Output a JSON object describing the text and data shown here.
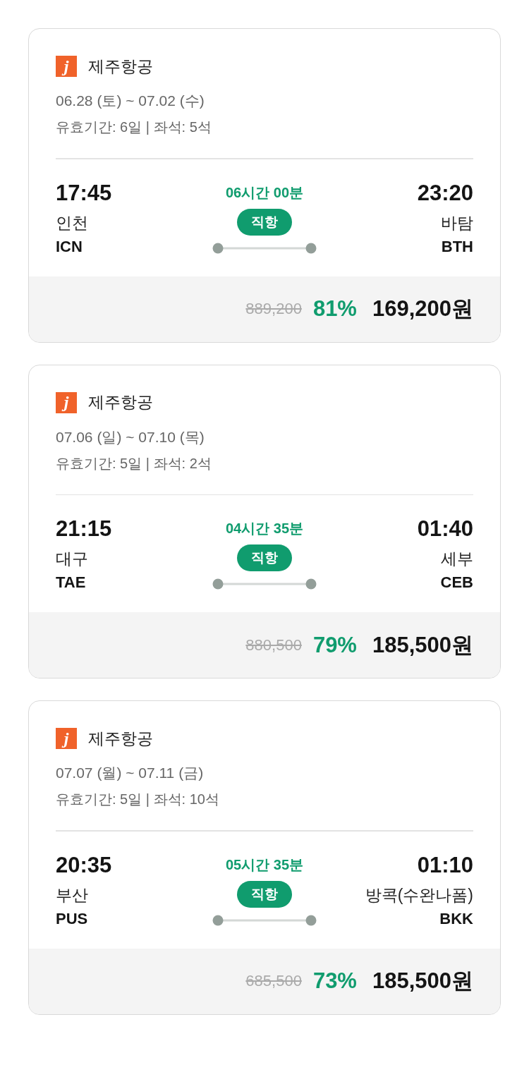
{
  "flights": [
    {
      "airline": "제주항공",
      "logo": "j",
      "dates": "06.28 (토) ~ 07.02 (수)",
      "info": "유효기간: 6일 | 좌석: 5석",
      "depart_time": "17:45",
      "depart_city": "인천",
      "depart_code": "ICN",
      "duration": "06시간 00분",
      "route_type": "직항",
      "arrive_time": "23:20",
      "arrive_city": "바탐",
      "arrive_code": "BTH",
      "original_price": "889,200",
      "discount": "81%",
      "price": "169,200원"
    },
    {
      "airline": "제주항공",
      "logo": "j",
      "dates": "07.06 (일) ~ 07.10 (목)",
      "info": "유효기간: 5일 | 좌석: 2석",
      "depart_time": "21:15",
      "depart_city": "대구",
      "depart_code": "TAE",
      "duration": "04시간 35분",
      "route_type": "직항",
      "arrive_time": "01:40",
      "arrive_city": "세부",
      "arrive_code": "CEB",
      "original_price": "880,500",
      "discount": "79%",
      "price": "185,500원"
    },
    {
      "airline": "제주항공",
      "logo": "j",
      "dates": "07.07 (월) ~ 07.11 (금)",
      "info": "유효기간: 5일 | 좌석: 10석",
      "depart_time": "20:35",
      "depart_city": "부산",
      "depart_code": "PUS",
      "duration": "05시간 35분",
      "route_type": "직항",
      "arrive_time": "01:10",
      "arrive_city": "방콕(수완나폼)",
      "arrive_code": "BKK",
      "original_price": "685,500",
      "discount": "73%",
      "price": "185,500원"
    }
  ]
}
